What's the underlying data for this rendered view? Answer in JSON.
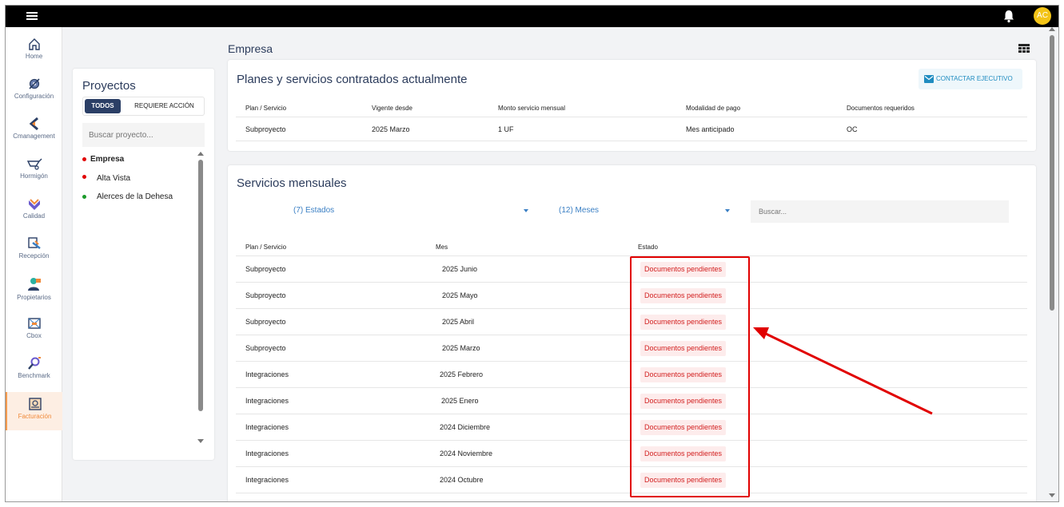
{
  "topbar": {
    "avatar_initials": "AC",
    "icons": [
      "menu-icon",
      "bell-icon"
    ]
  },
  "sidebar": {
    "items": [
      {
        "label": "Home",
        "icon": "home-icon"
      },
      {
        "label": "Configuración",
        "icon": "gear-icon"
      },
      {
        "label": "Cmanagement",
        "icon": "cmanagement-icon"
      },
      {
        "label": "Hormigón",
        "icon": "wheelbarrow-icon"
      },
      {
        "label": "Calidad",
        "icon": "quality-check-icon"
      },
      {
        "label": "Recepción",
        "icon": "reception-icon"
      },
      {
        "label": "Propietarios",
        "icon": "owners-icon"
      },
      {
        "label": "Cbox",
        "icon": "cbox-icon"
      },
      {
        "label": "Benchmark",
        "icon": "benchmark-icon"
      },
      {
        "label": "Facturación",
        "icon": "billing-icon",
        "active": true
      }
    ]
  },
  "projects": {
    "title": "Proyectos",
    "tab_all": "TODOS",
    "tab_action": "REQUIERE ACCIÓN",
    "search_placeholder": "Buscar proyecto...",
    "items": [
      {
        "name": "Empresa",
        "dot_color": "#e10000",
        "bold": true
      },
      {
        "name": "Alta Vista",
        "dot_color": "#e10000"
      },
      {
        "name": "Alerces de la Dehesa",
        "dot_color": "#1a9a2a"
      }
    ]
  },
  "page": {
    "title": "Empresa"
  },
  "plans": {
    "title": "Planes y servicios contratados actualmente",
    "contact_label": "CONTACTAR EJECUTIVO",
    "headers": [
      "Plan / Servicio",
      "Vigente desde",
      "Monto servicio mensual",
      "Modalidad de pago",
      "Documentos requeridos"
    ],
    "row": [
      "Subproyecto",
      "2025 Marzo",
      "1 UF",
      "Mes anticipado",
      "OC"
    ]
  },
  "monthly": {
    "title": "Servicios mensuales",
    "filter_states": "(7) Estados",
    "filter_months": "(12) Meses",
    "search_placeholder": "Buscar...",
    "headers": [
      "Plan / Servicio",
      "Mes",
      "Estado"
    ],
    "rows": [
      [
        "Subproyecto",
        "2025 Junio",
        "Documentos pendientes"
      ],
      [
        "Subproyecto",
        "2025 Mayo",
        "Documentos pendientes"
      ],
      [
        "Subproyecto",
        "2025 Abril",
        "Documentos pendientes"
      ],
      [
        "Subproyecto",
        "2025 Marzo",
        "Documentos pendientes"
      ],
      [
        "Integraciones",
        "2025 Febrero",
        "Documentos pendientes"
      ],
      [
        "Integraciones",
        "2025 Enero",
        "Documentos pendientes"
      ],
      [
        "Integraciones",
        "2024 Diciembre",
        "Documentos pendientes"
      ],
      [
        "Integraciones",
        "2024 Noviembre",
        "Documentos pendientes"
      ],
      [
        "Integraciones",
        "2024 Octubre",
        "Documentos pendientes"
      ]
    ]
  },
  "colors": {
    "navy": "#2b3f66",
    "accent_orange": "#f08a3a",
    "badge_red": "#d21e1e",
    "annotation_red": "#e10000"
  }
}
